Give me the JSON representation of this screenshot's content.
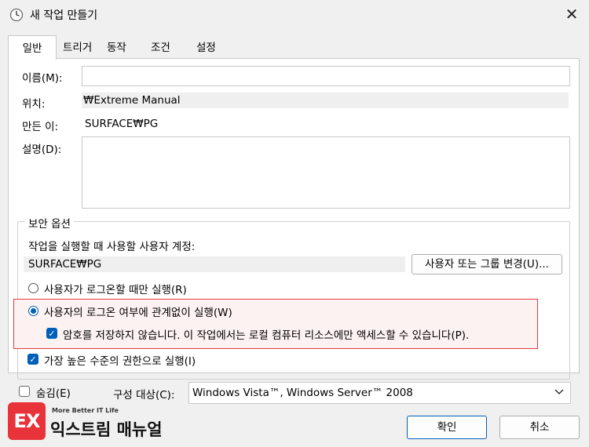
{
  "window": {
    "title": "새 작업 만들기"
  },
  "tabs": [
    {
      "label": "일반"
    },
    {
      "label": "트리거"
    },
    {
      "label": "동작"
    },
    {
      "label": "조건"
    },
    {
      "label": "설정"
    }
  ],
  "general": {
    "name_label": "이름(M):",
    "name_value": "",
    "location_label": "위치:",
    "location_value": "₩Extreme Manual",
    "author_label": "만든 이:",
    "author_value": "SURFACE₩PG",
    "description_label": "설명(D):",
    "description_value": ""
  },
  "security": {
    "group_title": "보안 옵션",
    "account_prompt": "작업을 실행할 때 사용할 사용자 계정:",
    "account_value": "SURFACE₩PG",
    "change_user_button": "사용자 또는 그룹 변경(U)...",
    "radio_logged_on": "사용자가 로그온할 때만 실행(R)",
    "radio_whether": "사용자의 로그온 여부에 관계없이 실행(W)",
    "do_not_store_password": "암호를 저장하지 않습니다. 이 작업에서는 로컬 컴퓨터 리소스에만 액세스할 수 있습니다(P).",
    "highest_privileges": "가장 높은 수준의 권한으로 실행(I)"
  },
  "footer": {
    "hidden_label": "숨김(E)",
    "configure_label": "구성 대상(C):",
    "configure_value": "Windows Vista™, Windows Server™ 2008",
    "ok_button": "확인",
    "cancel_button": "취소"
  },
  "watermark": {
    "tagline": "More Better IT Life",
    "brand": "익스트림 매뉴얼",
    "logo_letters": "EX"
  },
  "colors": {
    "accent": "#005fb8",
    "highlight_border": "#e03c3c",
    "logo_red": "#e8333b"
  }
}
